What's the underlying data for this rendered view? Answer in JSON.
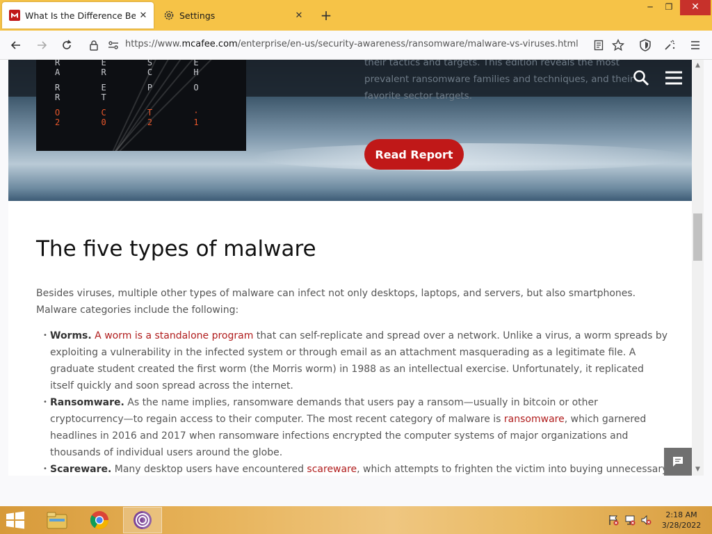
{
  "browser": {
    "tabs": [
      {
        "title": "What Is the Difference Between",
        "favicon": "mcafee-logo-icon",
        "active": true
      },
      {
        "title": "Settings",
        "favicon": "gear-icon",
        "active": false
      }
    ],
    "url": {
      "prefix": "https://www.",
      "host": "mcafee.com",
      "path": "/enterprise/en-us/security-awareness/ransomware/malware-vs-viruses.html"
    }
  },
  "hero": {
    "report_lines": [
      "R E S E A R C H",
      "R E P O R T",
      "O C T · 2 0 2 1"
    ],
    "description": "their tactics and targets. This edition reveals the most prevalent ransomware families and techniques, and their favorite sector targets.",
    "button_label": "Read Report"
  },
  "article": {
    "heading": "The five types of malware",
    "intro": "Besides viruses, multiple other types of malware can infect not only desktops, laptops, and servers, but also smartphones. Malware categories include the following:",
    "items": [
      {
        "term": "Worms.",
        "link": "A worm is a standalone program",
        "text": " that can self-replicate and spread over a network. Unlike a virus, a worm spreads by exploiting a vulnerability in the infected system or through email as an attachment masquerading as a legitimate file. A graduate student created the first worm (the Morris worm) in 1988 as an intellectual exercise. Unfortunately, it replicated itself quickly and soon spread across the internet."
      },
      {
        "term": "Ransomware.",
        "text_before": " As the name implies, ransomware demands that users pay a ransom—usually in bitcoin or other cryptocurrency—to regain access to their computer. The most recent category of malware is ",
        "link": "ransomware",
        "text": ", which garnered headlines in 2016 and 2017 when ransomware infections encrypted the computer systems of major organizations and thousands of individual users around the globe."
      },
      {
        "term": "Scareware.",
        "text_before": " Many desktop users have encountered ",
        "link": "scareware",
        "text": ", which attempts to frighten the victim into buying unnecessary software"
      }
    ]
  },
  "taskbar": {
    "clock_time": "2:18 AM",
    "clock_date": "3/28/2022"
  },
  "colors": {
    "accent_red": "#c01818",
    "link_red": "#b01c1c",
    "titlebar": "#f6c347"
  }
}
